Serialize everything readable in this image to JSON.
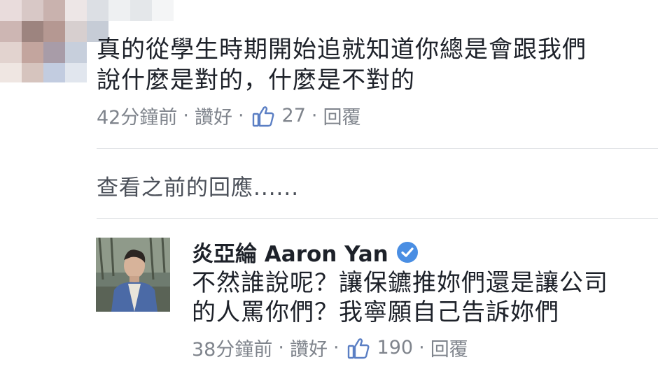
{
  "comment1": {
    "line1": "真的從學生時期開始追就知道你總是會跟我們",
    "line2": "說什麼是對的，什麼是不對的",
    "time": "42分鐘前",
    "like": "讚好",
    "like_count": "27",
    "reply": "回覆",
    "sep": "·"
  },
  "view_previous": "查看之前的回應......",
  "reply1": {
    "author": "炎亞綸 Aaron Yan",
    "verified_icon": "verified-badge-icon",
    "line1": "不然誰說呢？讓保鑣推妳們還是讓公司",
    "line2": "的人罵你們？我寧願自己告訴妳們",
    "time": "38分鐘前",
    "like": "讚好",
    "like_count": "190",
    "reply": "回覆",
    "sep": "·"
  },
  "colors": {
    "meta_gray": "#7f848c",
    "verified_blue": "#4a8ee3",
    "thumb_blue": "#5b7fc4"
  }
}
